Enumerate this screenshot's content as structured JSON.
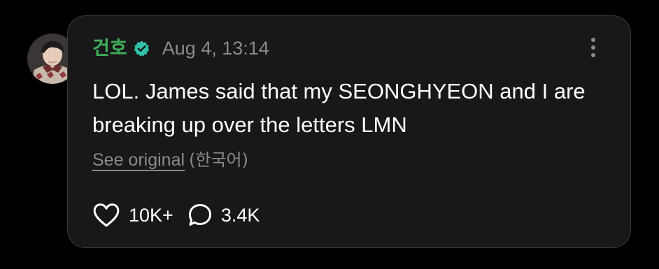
{
  "post": {
    "author": "건호",
    "verified_icon": "verified-badge-icon",
    "timestamp": "Aug 4, 13:14",
    "text": "LOL. James said that my SEONGHYEON and I are breaking up over the letters LMN",
    "translation": {
      "link_label": "See original",
      "language": "(한국어)"
    },
    "stats": {
      "likes": "10K+",
      "replies": "3.4K"
    }
  },
  "colors": {
    "background": "#000000",
    "card": "#181818",
    "username": "#3fae5a",
    "verified_badge": "#2fc2a8",
    "muted_text": "#8a8a8a",
    "body_text": "#ffffff"
  },
  "icons": {
    "more": "more-vertical-icon",
    "like": "heart-outline-icon",
    "reply": "speech-bubble-icon"
  }
}
